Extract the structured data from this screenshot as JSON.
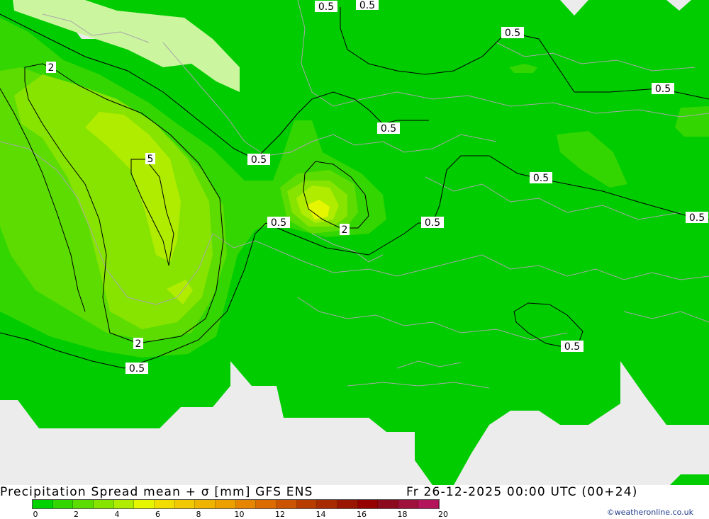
{
  "title": "Precipitation Spread mean + σ [mm] GFS ENS",
  "datetime": "Fr 26-12-2025 00:00 UTC (00+24)",
  "credit": "©weatheronline.co.uk",
  "legend": {
    "colors": [
      "#00d200",
      "#33d600",
      "#5cdc00",
      "#86e400",
      "#b0ec00",
      "#e6f500",
      "#f2dd00",
      "#f2c800",
      "#efb400",
      "#eca000",
      "#e68600",
      "#dc6c00",
      "#cc5400",
      "#b83c00",
      "#a82a00",
      "#9a1600",
      "#960000",
      "#8c0a1e",
      "#a0103c",
      "#b4145a"
    ],
    "tick_labels": [
      "0",
      "2",
      "4",
      "6",
      "8",
      "10",
      "12",
      "14",
      "16",
      "18",
      "20"
    ]
  },
  "contour_labels": [
    "0.5",
    "0.5",
    "0.5",
    "0.5",
    "0.5",
    "0.5",
    "0.5",
    "0.5",
    "0.5",
    "0.5",
    "0.5",
    "0.5",
    "2",
    "2",
    "2",
    "5"
  ]
}
